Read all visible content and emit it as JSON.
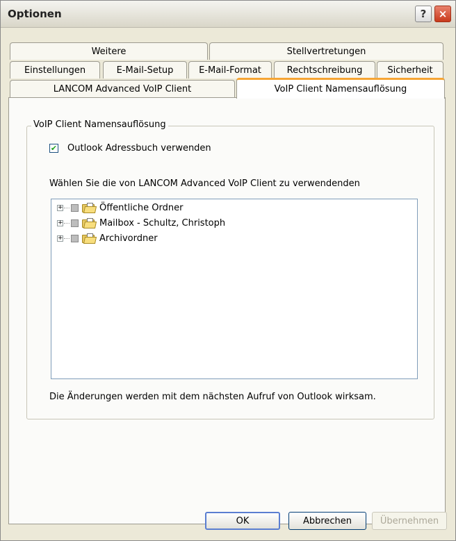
{
  "window": {
    "title": "Optionen",
    "help_glyph": "?",
    "close_glyph": "×"
  },
  "tabs": {
    "row1": [
      "Weitere",
      "Stellvertretungen"
    ],
    "row2": [
      "Einstellungen",
      "E-Mail-Setup",
      "E-Mail-Format",
      "Rechtschreibung",
      "Sicherheit"
    ],
    "row3": [
      "LANCOM Advanced VoIP Client",
      "VoIP Client Namensauflösung"
    ],
    "active": "VoIP Client Namensauflösung"
  },
  "group": {
    "legend": "VoIP Client Namensauflösung",
    "checkbox_label": "Outlook Adressbuch verwenden",
    "checkbox_checked": true,
    "checkbox_glyph": "✔",
    "description": "Wählen Sie die von LANCOM Advanced VoIP Client zu verwendenden",
    "tree": [
      {
        "label": "Öffentliche Ordner",
        "expander": "+"
      },
      {
        "label": "Mailbox - Schultz, Christoph",
        "expander": "+"
      },
      {
        "label": "Archivordner",
        "expander": "+"
      }
    ],
    "note": "Die Änderungen werden mit dem nächsten Aufruf von Outlook wirksam."
  },
  "buttons": {
    "ok": "OK",
    "cancel": "Abbrechen",
    "apply": "Übernehmen"
  }
}
